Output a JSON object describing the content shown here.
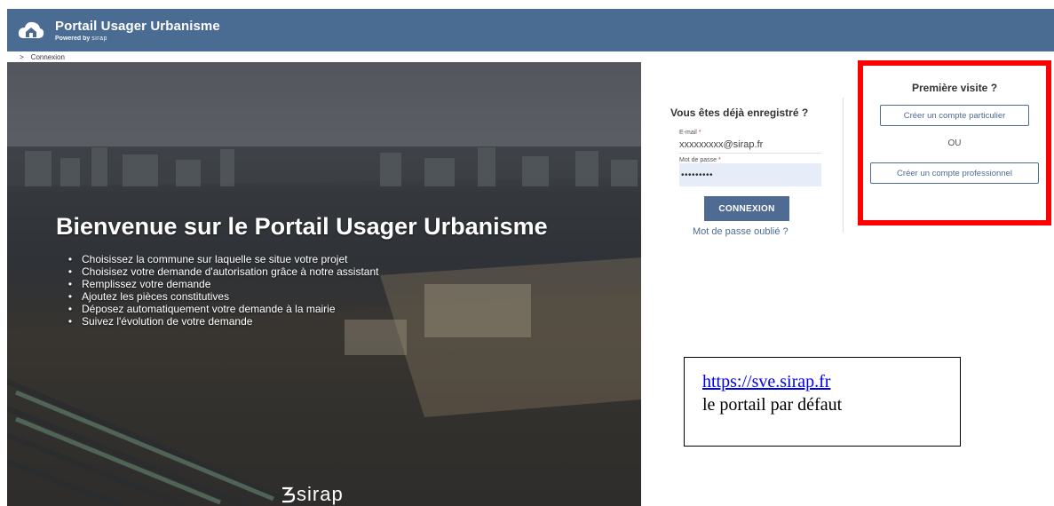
{
  "header": {
    "title": "Portail Usager Urbanisme",
    "powered_by": "Powered by",
    "powered_brand": "sirap",
    "logo_icon": "cloud-house-icon"
  },
  "breadcrumb": {
    "separator": ">",
    "current": "Connexion"
  },
  "hero": {
    "title": "Bienvenue sur le Portail Usager Urbanisme",
    "bullet": "•",
    "items": [
      "Choisissez la commune sur laquelle se situe votre projet",
      "Choisisez votre demande d'autorisation grâce à notre assistant",
      "Remplissez votre demande",
      "Ajoutez les pièces constitutives",
      "Déposez automatiquement votre demande à la mairie",
      "Suivez l'évolution de votre demande"
    ],
    "logo_text": "sirap"
  },
  "login": {
    "title": "Vous êtes déjà enregistré ?",
    "email_label": "E-mail",
    "email_value": "xxxxxxxxx@sirap.fr",
    "password_label": "Mot de passe",
    "password_value": "•••••••••",
    "required_mark": "*",
    "submit_label": "CONNEXION",
    "forgot_label": "Mot de passe oublié ?"
  },
  "first_visit": {
    "title": "Première visite ?",
    "particulier_label": "Créer un compte particulier",
    "or_label": "OU",
    "pro_label": "Créer un compte professionnel"
  },
  "annotation": {
    "url": "https://sve.sirap.fr",
    "text": "le portail par défaut"
  },
  "colors": {
    "header_bg": "#4a6b92",
    "accent": "#4f6a93",
    "highlight_border": "#ff0000",
    "link": "#0000ee"
  }
}
